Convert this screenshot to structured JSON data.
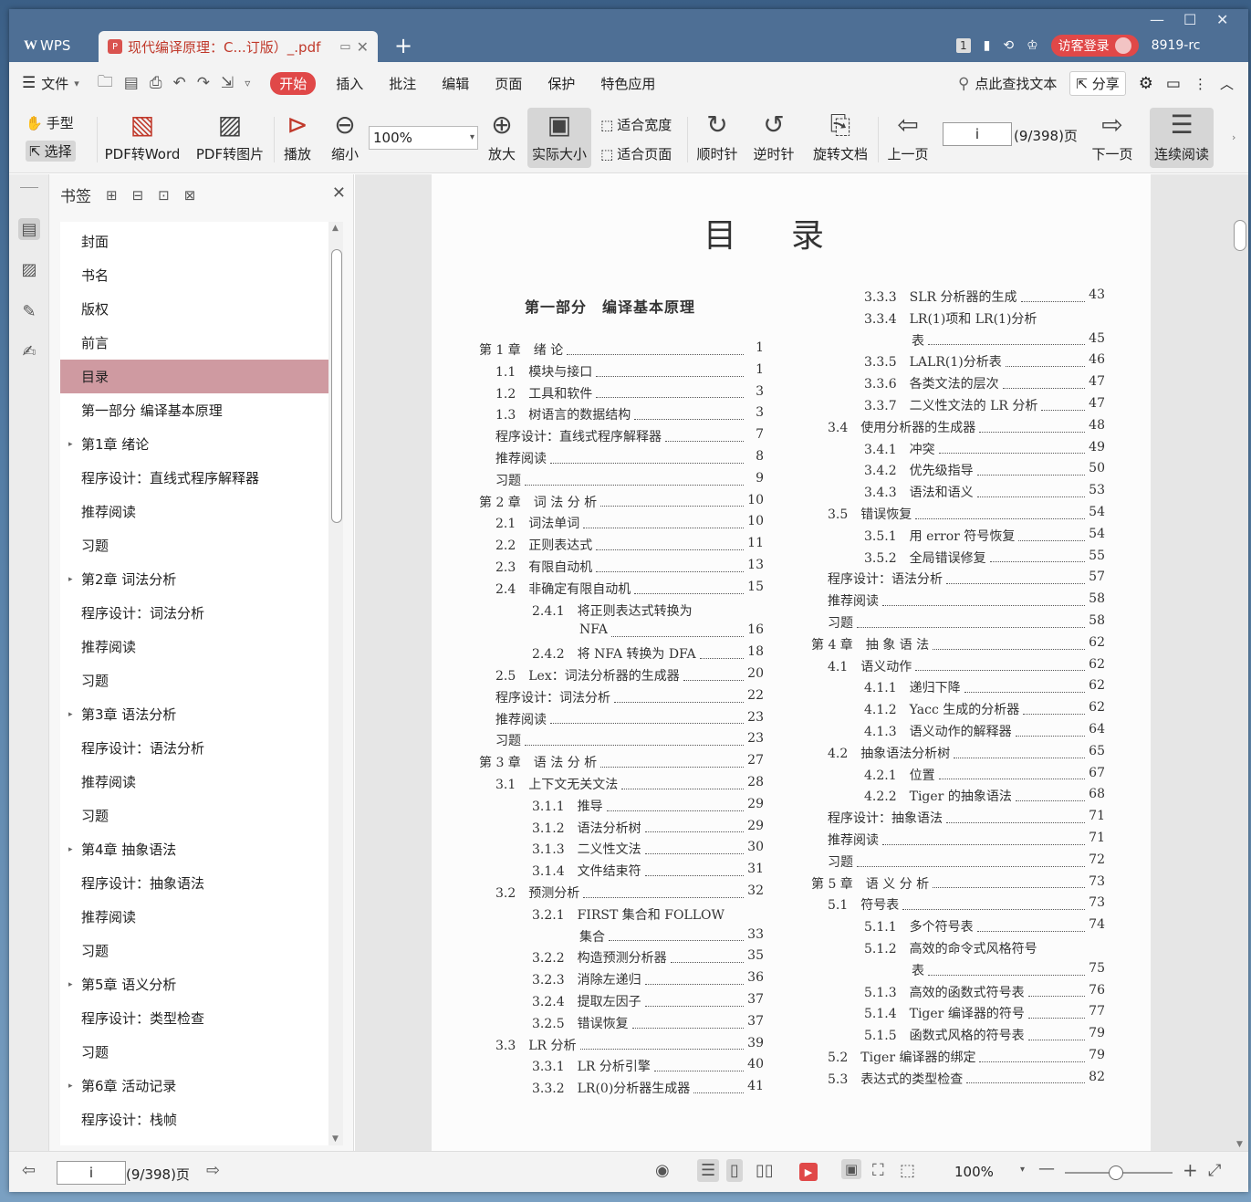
{
  "titlebar": {
    "app_tab": "WPS",
    "doc_tab_title": "现代编译原理：C...订版）_.pdf",
    "page_badge": "1",
    "login_label": "访客登录",
    "user_id": "8919-rc"
  },
  "menubar": {
    "file_label": "文件",
    "tabs": [
      "开始",
      "插入",
      "批注",
      "编辑",
      "页面",
      "保护",
      "特色应用"
    ],
    "search_label": "点此查找文本",
    "share_label": "分享"
  },
  "ribbon": {
    "hand_label": "手型",
    "select_label": "选择",
    "pdf_to_word": "PDF转Word",
    "pdf_to_image": "PDF转图片",
    "play_label": "播放",
    "zoom_out_label": "缩小",
    "zoom_value": "100%",
    "zoom_in_label": "放大",
    "actual_size_label": "实际大小",
    "fit_width_label": "适合宽度",
    "fit_page_label": "适合页面",
    "clockwise_label": "顺时针",
    "counterclockwise_label": "逆时针",
    "rotate_doc_label": "旋转文档",
    "prev_page_label": "上一页",
    "page_input": "i",
    "page_count": "(9/398)页",
    "next_page_label": "下一页",
    "continuous_label": "连续阅读"
  },
  "bookmarks": {
    "title": "书签",
    "items": [
      {
        "label": "封面",
        "expandable": false
      },
      {
        "label": "书名",
        "expandable": false
      },
      {
        "label": "版权",
        "expandable": false
      },
      {
        "label": "前言",
        "expandable": false
      },
      {
        "label": "目录",
        "expandable": false,
        "selected": true
      },
      {
        "label": "第一部分 编译基本原理",
        "expandable": false
      },
      {
        "label": "第1章 绪论",
        "expandable": true
      },
      {
        "label": "程序设计：直线式程序解释器",
        "expandable": false
      },
      {
        "label": "推荐阅读",
        "expandable": false
      },
      {
        "label": "习题",
        "expandable": false
      },
      {
        "label": "第2章 词法分析",
        "expandable": true
      },
      {
        "label": "程序设计：词法分析",
        "expandable": false
      },
      {
        "label": "推荐阅读",
        "expandable": false
      },
      {
        "label": "习题",
        "expandable": false
      },
      {
        "label": "第3章 语法分析",
        "expandable": true
      },
      {
        "label": "程序设计：语法分析",
        "expandable": false
      },
      {
        "label": "推荐阅读",
        "expandable": false
      },
      {
        "label": "习题",
        "expandable": false
      },
      {
        "label": "第4章 抽象语法",
        "expandable": true
      },
      {
        "label": "程序设计：抽象语法",
        "expandable": false
      },
      {
        "label": "推荐阅读",
        "expandable": false
      },
      {
        "label": "习题",
        "expandable": false
      },
      {
        "label": "第5章 语义分析",
        "expandable": true
      },
      {
        "label": "程序设计：类型检查",
        "expandable": false
      },
      {
        "label": "习题",
        "expandable": false
      },
      {
        "label": "第6章 活动记录",
        "expandable": true
      },
      {
        "label": "程序设计：栈帧",
        "expandable": false
      }
    ]
  },
  "document": {
    "title": "目录",
    "part_title": "第一部分　编译基本原理",
    "left_column": [
      {
        "text": "第 1 章　绪 论",
        "page": "1",
        "indent": 0
      },
      {
        "text": "1.1　模块与接口",
        "page": "1",
        "indent": 1
      },
      {
        "text": "1.2　工具和软件",
        "page": "3",
        "indent": 1
      },
      {
        "text": "1.3　树语言的数据结构",
        "page": "3",
        "indent": 1
      },
      {
        "text": "程序设计：直线式程序解释器",
        "page": "7",
        "indent": 1
      },
      {
        "text": "推荐阅读",
        "page": "8",
        "indent": 1
      },
      {
        "text": "习题",
        "page": "9",
        "indent": 1
      },
      {
        "text": "第 2 章　词 法 分 析",
        "page": "10",
        "indent": 0
      },
      {
        "text": "2.1　词法单词",
        "page": "10",
        "indent": 1
      },
      {
        "text": "2.2　正则表达式",
        "page": "11",
        "indent": 1
      },
      {
        "text": "2.3　有限自动机",
        "page": "13",
        "indent": 1
      },
      {
        "text": "2.4　非确定有限自动机",
        "page": "15",
        "indent": 1
      },
      {
        "text": "2.4.1　将正则表达式转换为",
        "page": "",
        "indent": 2
      },
      {
        "text": "NFA",
        "page": "16",
        "indent": 3
      },
      {
        "text": "2.4.2　将 NFA 转换为 DFA",
        "page": "18",
        "indent": 2
      },
      {
        "text": "2.5　Lex：词法分析器的生成器",
        "page": "20",
        "indent": 1
      },
      {
        "text": "程序设计：词法分析",
        "page": "22",
        "indent": 1
      },
      {
        "text": "推荐阅读",
        "page": "23",
        "indent": 1
      },
      {
        "text": "习题",
        "page": "23",
        "indent": 1
      },
      {
        "text": "第 3 章　语 法 分 析",
        "page": "27",
        "indent": 0
      },
      {
        "text": "3.1　上下文无关文法",
        "page": "28",
        "indent": 1
      },
      {
        "text": "3.1.1　推导",
        "page": "29",
        "indent": 2
      },
      {
        "text": "3.1.2　语法分析树",
        "page": "29",
        "indent": 2
      },
      {
        "text": "3.1.3　二义性文法",
        "page": "30",
        "indent": 2
      },
      {
        "text": "3.1.4　文件结束符",
        "page": "31",
        "indent": 2
      },
      {
        "text": "3.2　预测分析",
        "page": "32",
        "indent": 1
      },
      {
        "text": "3.2.1　FIRST 集合和 FOLLOW",
        "page": "",
        "indent": 2
      },
      {
        "text": "集合",
        "page": "33",
        "indent": 3
      },
      {
        "text": "3.2.2　构造预测分析器",
        "page": "35",
        "indent": 2
      },
      {
        "text": "3.2.3　消除左递归",
        "page": "36",
        "indent": 2
      },
      {
        "text": "3.2.4　提取左因子",
        "page": "37",
        "indent": 2
      },
      {
        "text": "3.2.5　错误恢复",
        "page": "37",
        "indent": 2
      },
      {
        "text": "3.3　LR 分析",
        "page": "39",
        "indent": 1
      },
      {
        "text": "3.3.1　LR 分析引擎",
        "page": "40",
        "indent": 2
      },
      {
        "text": "3.3.2　LR(0)分析器生成器",
        "page": "41",
        "indent": 2
      }
    ],
    "right_column": [
      {
        "text": "3.3.3　SLR 分析器的生成",
        "page": "43",
        "indent": 2
      },
      {
        "text": "3.3.4　LR(1)项和 LR(1)分析",
        "page": "",
        "indent": 2
      },
      {
        "text": "表",
        "page": "45",
        "indent": 3
      },
      {
        "text": "3.3.5　LALR(1)分析表",
        "page": "46",
        "indent": 2
      },
      {
        "text": "3.3.6　各类文法的层次",
        "page": "47",
        "indent": 2
      },
      {
        "text": "3.3.7　二义性文法的 LR 分析",
        "page": "47",
        "indent": 2
      },
      {
        "text": "3.4　使用分析器的生成器",
        "page": "48",
        "indent": 1
      },
      {
        "text": "3.4.1　冲突",
        "page": "49",
        "indent": 2
      },
      {
        "text": "3.4.2　优先级指导",
        "page": "50",
        "indent": 2
      },
      {
        "text": "3.4.3　语法和语义",
        "page": "53",
        "indent": 2
      },
      {
        "text": "3.5　错误恢复",
        "page": "54",
        "indent": 1
      },
      {
        "text": "3.5.1　用 error 符号恢复",
        "page": "54",
        "indent": 2
      },
      {
        "text": "3.5.2　全局错误修复",
        "page": "55",
        "indent": 2
      },
      {
        "text": "程序设计：语法分析",
        "page": "57",
        "indent": 1
      },
      {
        "text": "推荐阅读",
        "page": "58",
        "indent": 1
      },
      {
        "text": "习题",
        "page": "58",
        "indent": 1
      },
      {
        "text": "第 4 章　抽 象 语 法",
        "page": "62",
        "indent": 0
      },
      {
        "text": "4.1　语义动作",
        "page": "62",
        "indent": 1
      },
      {
        "text": "4.1.1　递归下降",
        "page": "62",
        "indent": 2
      },
      {
        "text": "4.1.2　Yacc 生成的分析器",
        "page": "62",
        "indent": 2
      },
      {
        "text": "4.1.3　语义动作的解释器",
        "page": "64",
        "indent": 2
      },
      {
        "text": "4.2　抽象语法分析树",
        "page": "65",
        "indent": 1
      },
      {
        "text": "4.2.1　位置",
        "page": "67",
        "indent": 2
      },
      {
        "text": "4.2.2　Tiger 的抽象语法",
        "page": "68",
        "indent": 2
      },
      {
        "text": "程序设计：抽象语法",
        "page": "71",
        "indent": 1
      },
      {
        "text": "推荐阅读",
        "page": "71",
        "indent": 1
      },
      {
        "text": "习题",
        "page": "72",
        "indent": 1
      },
      {
        "text": "第 5 章　语 义 分 析",
        "page": "73",
        "indent": 0
      },
      {
        "text": "5.1　符号表",
        "page": "73",
        "indent": 1
      },
      {
        "text": "5.1.1　多个符号表",
        "page": "74",
        "indent": 2
      },
      {
        "text": "5.1.2　高效的命令式风格符号",
        "page": "",
        "indent": 2
      },
      {
        "text": "表",
        "page": "75",
        "indent": 3
      },
      {
        "text": "5.1.3　高效的函数式符号表",
        "page": "76",
        "indent": 2
      },
      {
        "text": "5.1.4　Tiger 编译器的符号",
        "page": "77",
        "indent": 2
      },
      {
        "text": "5.1.5　函数式风格的符号表",
        "page": "79",
        "indent": 2
      },
      {
        "text": "5.2　Tiger 编译器的绑定",
        "page": "79",
        "indent": 1
      },
      {
        "text": "5.3　表达式的类型检查",
        "page": "82",
        "indent": 1
      }
    ]
  },
  "statusbar": {
    "page_input": "i",
    "page_count": "(9/398)页",
    "zoom_value": "100%"
  }
}
